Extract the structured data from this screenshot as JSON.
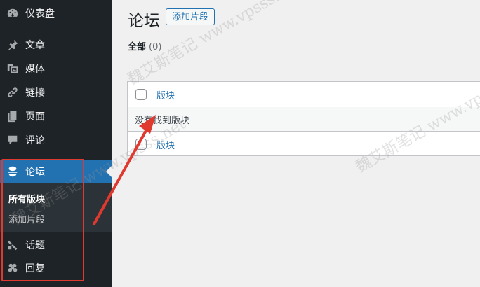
{
  "sidebar": {
    "items": [
      {
        "label": "仪表盘",
        "icon": "dashboard-icon"
      },
      {
        "label": "文章",
        "icon": "pin-icon"
      },
      {
        "label": "媒体",
        "icon": "media-icon"
      },
      {
        "label": "链接",
        "icon": "link-icon"
      },
      {
        "label": "页面",
        "icon": "page-icon"
      },
      {
        "label": "评论",
        "icon": "comment-icon"
      },
      {
        "label": "论坛",
        "icon": "forum-icon"
      },
      {
        "label": "话题",
        "icon": "topic-icon"
      },
      {
        "label": "回复",
        "icon": "reply-icon"
      }
    ],
    "submenu": [
      {
        "label": "所有版块"
      },
      {
        "label": "添加片段"
      }
    ]
  },
  "header": {
    "title": "论坛",
    "add_button": "添加片段"
  },
  "filters": {
    "all_label": "全部",
    "all_count": "(0)"
  },
  "table": {
    "column_header": "版块",
    "empty_message": "没有找到版块",
    "column_footer": "版块"
  },
  "watermark": {
    "text": "魏艾斯笔记 www.vpsss.net"
  },
  "colors": {
    "sidebar_bg": "#1d2327",
    "accent": "#2271b1",
    "annotation_red": "#e0392f"
  }
}
